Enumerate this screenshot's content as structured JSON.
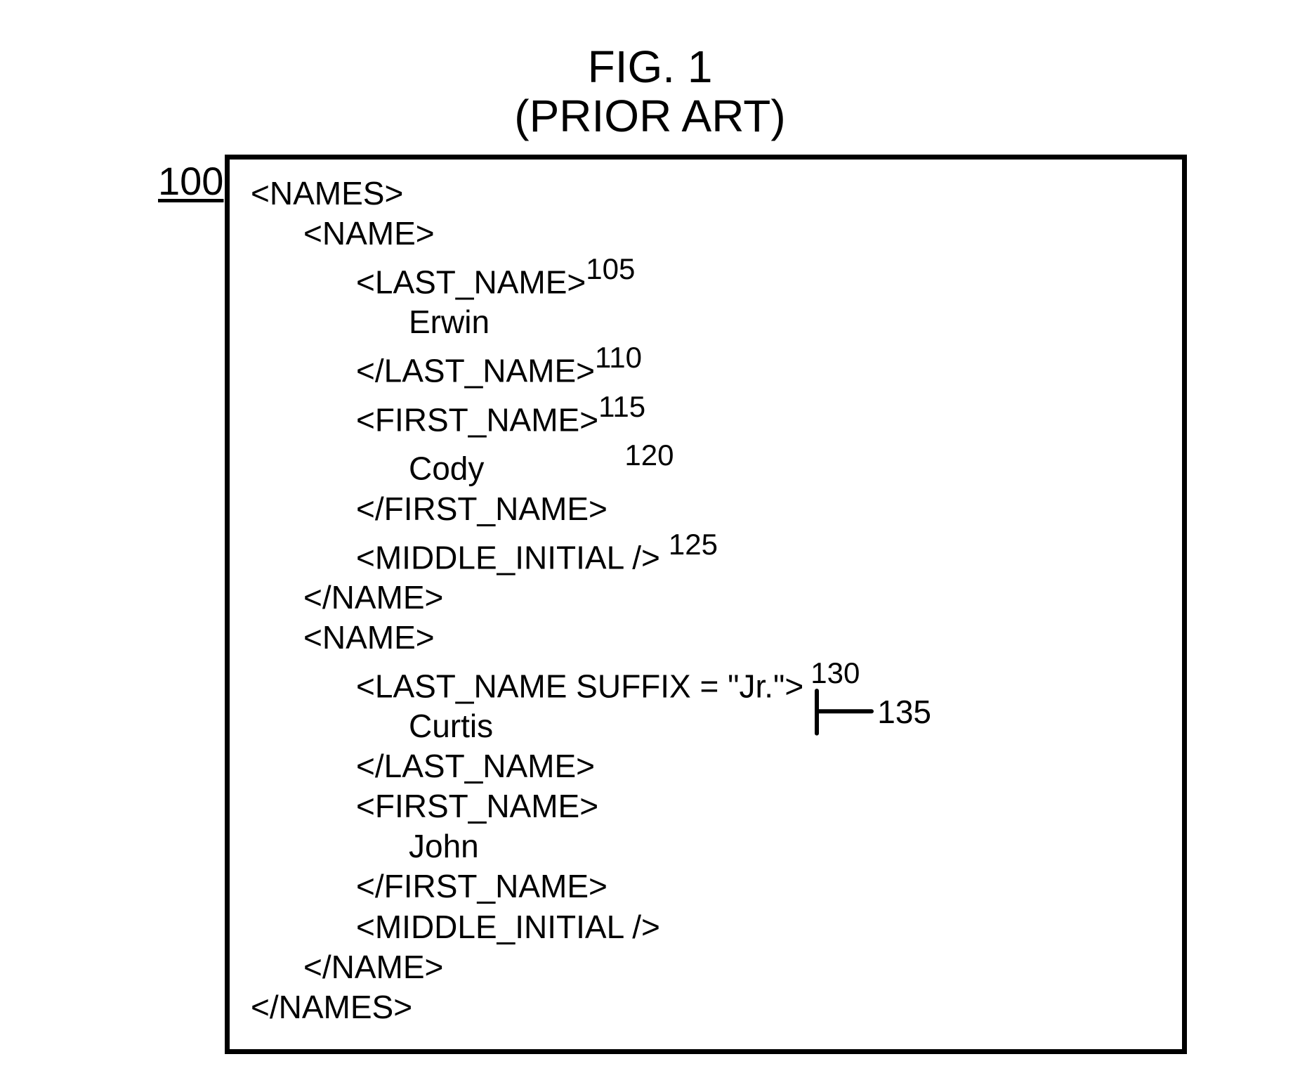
{
  "figure": {
    "number": "FIG. 1",
    "subtitle": "(PRIOR ART)"
  },
  "refs": {
    "box": "100",
    "r105": "105",
    "r110": "110",
    "r115": "115",
    "r120": "120",
    "r125": "125",
    "r130": "130",
    "r135": "135"
  },
  "xml": {
    "names_open": "<NAMES>",
    "names_close": "</NAMES>",
    "name_open": "<NAME>",
    "name_close": "</NAME>",
    "lastname_open": "<LAST_NAME>",
    "lastname_close": "</LAST_NAME>",
    "lastname_open_suffix": "<LAST_NAME SUFFIX = \"Jr.\">",
    "firstname_open": "<FIRST_NAME>",
    "firstname_close": "</FIRST_NAME>",
    "middle_initial": "<MIDDLE_INITIAL />"
  },
  "values": {
    "erwin": "Erwin",
    "cody": "Cody",
    "curtis": "Curtis",
    "john": "John"
  }
}
